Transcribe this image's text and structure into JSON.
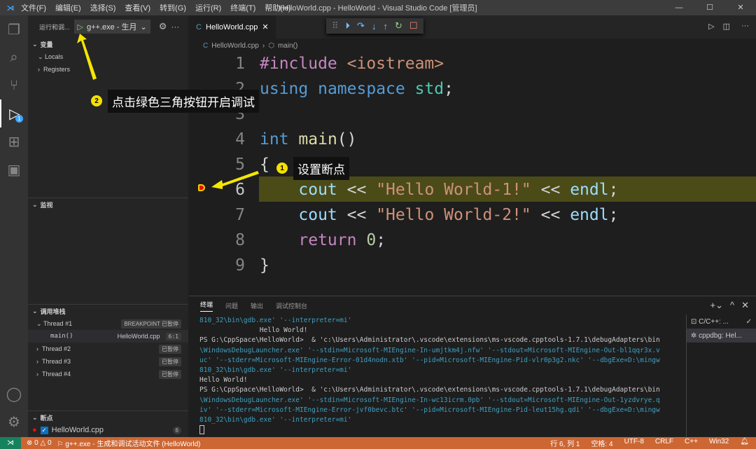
{
  "titlebar": {
    "menu": [
      "文件(F)",
      "编辑(E)",
      "选择(S)",
      "查看(V)",
      "转到(G)",
      "运行(R)",
      "终端(T)",
      "帮助(H)"
    ],
    "title": "HelloWorld.cpp - HelloWorld - Visual Studio Code [管理员]"
  },
  "sidebar": {
    "header": "运行和调...",
    "config": "g++.exe - 生月",
    "variables": "变量",
    "locals": "Locals",
    "registers": "Registers",
    "watch": "监视",
    "callstack": "调用堆栈",
    "threads": [
      {
        "name": "Thread #1",
        "status": "BREAKPOINT 已暂停"
      },
      {
        "name": "Thread #2",
        "status": "已暂停"
      },
      {
        "name": "Thread #3",
        "status": "已暂停"
      },
      {
        "name": "Thread #4",
        "status": "已暂停"
      }
    ],
    "frame": {
      "name": "main()",
      "file": "HelloWorld.cpp",
      "pos": "6:1"
    },
    "breakpoints": "断点",
    "bp_file": "HelloWorld.cpp",
    "bp_line": "6",
    "debug_badge": "1"
  },
  "editor": {
    "tab": "HelloWorld.cpp",
    "crumb_file": "HelloWorld.cpp",
    "crumb_symbol": "main()"
  },
  "panel": {
    "tabs": [
      "终端",
      "问题",
      "输出",
      "调试控制台"
    ],
    "lines": [
      {
        "t": "810_32\\bin\\gdb.exe' '--interpreter=mi'",
        "c": true
      },
      {
        "t": "               Hello World!",
        "c": false
      },
      {
        "t": "PS G:\\CppSpace\\HelloWorld>  & 'c:\\Users\\Administrator\\.vscode\\extensions\\ms-vscode.cpptools-1.7.1\\debugAdapters\\bin",
        "c": false
      },
      {
        "t": "\\WindowsDebugLauncher.exe' '--stdin=Microsoft-MIEngine-In-umjtkm4j.nfw' '--stdout=Microsoft-MIEngine-Out-bl1qqr3x.v",
        "c": true
      },
      {
        "t": "uc' '--stderr=Microsoft-MIEngine-Error-01d4nodn.xtb' '--pid=Microsoft-MIEngine-Pid-vlr0p3g2.nkc' '--dbgExe=D:\\mingw",
        "c": true
      },
      {
        "t": "810_32\\bin\\gdb.exe' '--interpreter=mi'",
        "c": true
      },
      {
        "t": "Hello World!",
        "c": false
      },
      {
        "t": "PS G:\\CppSpace\\HelloWorld>  & 'c:\\Users\\Administrator\\.vscode\\extensions\\ms-vscode.cpptools-1.7.1\\debugAdapters\\bin",
        "c": false
      },
      {
        "t": "\\WindowsDebugLauncher.exe' '--stdin=Microsoft-MIEngine-In-wc13icrm.0pb' '--stdout=Microsoft-MIEngine-Out-1yzdvrye.q",
        "c": true
      },
      {
        "t": "iv' '--stderr=Microsoft-MIEngine-Error-jvf0bevc.btc' '--pid=Microsoft-MIEngine-Pid-leut15hg.qdi' '--dbgExe=D:\\mingw",
        "c": true
      },
      {
        "t": "810_32\\bin\\gdb.exe' '--interpreter=mi'",
        "c": true
      }
    ],
    "terminals": [
      "C/C++: ...",
      "cppdbg: Hel..."
    ]
  },
  "status": {
    "errors": "0",
    "warnings": "0",
    "launch": "g++.exe - 生成和调试活动文件 (HelloWorld)",
    "position": "行 6, 列 1",
    "spaces": "空格: 4",
    "encoding": "UTF-8",
    "eol": "CRLF",
    "lang": "C++",
    "platform": "Win32"
  },
  "annotations": {
    "n1": "1",
    "t1": "设置断点",
    "n2": "2",
    "t2": "点击绿色三角按钮开启调试"
  }
}
